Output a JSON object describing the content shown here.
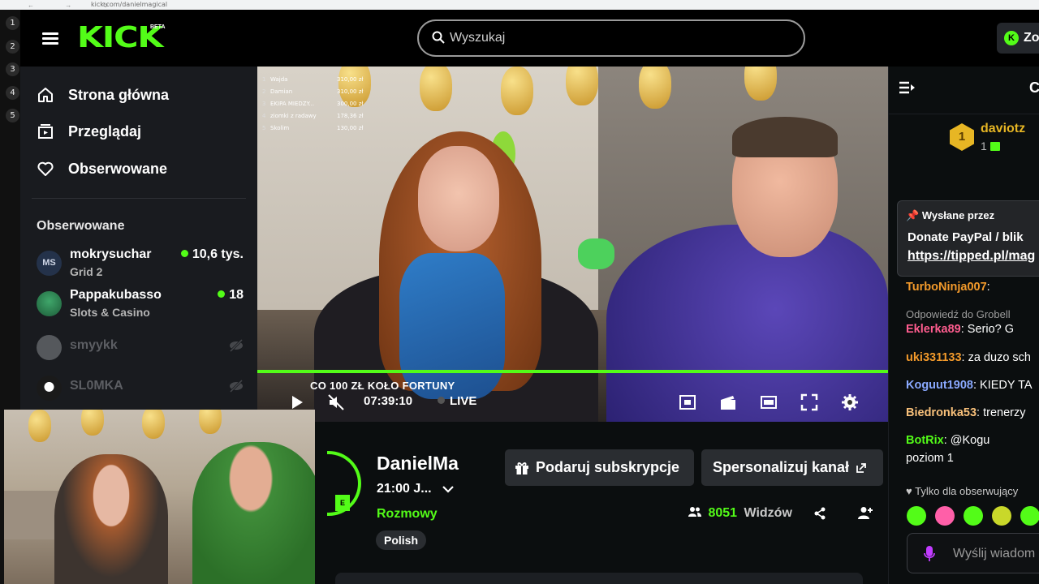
{
  "browser": {
    "url": "kick.com/danielmagical",
    "nav": "← → ↻"
  },
  "desktop_numbers": [
    "1",
    "2",
    "3",
    "4",
    "5"
  ],
  "header": {
    "logo": "KICK",
    "logo_badge": "BETA",
    "search_placeholder": "Wyszukaj",
    "signup_label": "Zo"
  },
  "sidenav": {
    "items": [
      {
        "label": "Strona główna",
        "icon": "home-icon"
      },
      {
        "label": "Przeglądaj",
        "icon": "browse-icon"
      },
      {
        "label": "Obserwowane",
        "icon": "heart-icon"
      }
    ],
    "followed_title": "Obserwowane",
    "channels": [
      {
        "name": "mokrysuchar",
        "category": "Grid 2",
        "viewers": "10,6 tys.",
        "live": true
      },
      {
        "name": "Pappakubasso",
        "category": "Slots & Casino",
        "viewers": "18",
        "live": true
      },
      {
        "name": "smyykk",
        "live": false
      },
      {
        "name": "SL0MKA",
        "live": false
      }
    ]
  },
  "video": {
    "leaderboard": [
      {
        "rank": "1",
        "name": "Wajda",
        "amount": "310,00 zł"
      },
      {
        "rank": "2",
        "name": "Damian",
        "amount": "310,00 zł"
      },
      {
        "rank": "3",
        "name": "EKIPA MIEDZY...",
        "amount": "300,00 zł"
      },
      {
        "rank": "4",
        "name": "ziomki z radawy",
        "amount": "178,36 zł"
      },
      {
        "rank": "5",
        "name": "Skolim",
        "amount": "130,00 zł"
      }
    ],
    "overlay_text": "CO 100 ZŁ KOŁO FORTUNY",
    "time": "07:39:10",
    "live_label": "LIVE",
    "progress": 1.0
  },
  "channel": {
    "name": "DanielMa",
    "stream_title": "21:00 J...",
    "category": "Rozmowy",
    "tag": "Polish",
    "live_badge": "E",
    "gift_button": "Podaruj subskrypcje",
    "customize_button": "Spersonalizuj kanał",
    "viewer_count": "8051",
    "viewer_label": "Widzów"
  },
  "chat": {
    "header": "C",
    "top_supporter": {
      "name": "daviotz",
      "rank": "1",
      "subs": "1"
    },
    "pinned": {
      "by": "Wysłane przez",
      "text": "Donate PayPal / blik",
      "link": "https://tipped.pl/mag"
    },
    "messages": [
      {
        "user": "TurboNinja007",
        "text": ":",
        "color": "#f39a2b"
      },
      {
        "user": "Eklerka89",
        "text": ": Serio? G",
        "color": "#ff5d8f"
      },
      {
        "user": "uki331133",
        "text": ": za duzo sch",
        "color": "#f39a2b"
      },
      {
        "user": "Koguut1908",
        "text": ": KIEDY TA",
        "color": "#8aa9ff"
      },
      {
        "user": "Biedronka53",
        "text": ": trenerzy",
        "color": "#f8c07a"
      },
      {
        "user": "BotRix",
        "text": ": @Kogu",
        "color": "#53fc18"
      },
      {
        "user": "",
        "text": "poziom 1",
        "color": "#ffffff"
      }
    ],
    "reply_hint": "Odpowiedź do Grobell",
    "followers_only": "Tylko dla obserwujący",
    "input_placeholder": "Wyślij wiadom"
  }
}
